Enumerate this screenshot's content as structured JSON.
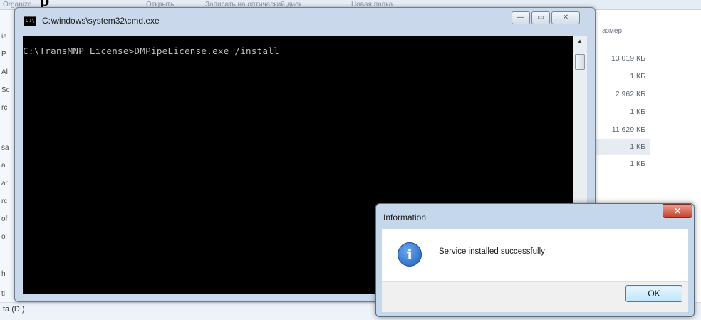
{
  "background": {
    "heading_fragment": "р",
    "toolbar": [
      "Organize",
      "Открыть",
      "Записать на оптический диск",
      "Новая папка"
    ],
    "left_pane_fragments": [
      "ia",
      "P",
      "Al",
      "Sc",
      "rc",
      "sa",
      "a",
      "ar",
      "rc",
      "of",
      "ol",
      "h",
      "ti"
    ],
    "column_header": "азмер",
    "file_sizes": [
      "13 019 КБ",
      "1 КБ",
      "2 962 КБ",
      "1 КБ",
      "11 629 КБ",
      "1 КБ",
      "1 КБ"
    ],
    "status_drive": "ta (D:)"
  },
  "cmd": {
    "title": "C:\\windows\\system32\\cmd.exe",
    "icon_label": "C:\\",
    "command_line": "C:\\TransMNP_License>DMPipeLicense.exe /install",
    "minimize_label": "—",
    "maximize_label": "▭",
    "close_label": "✕"
  },
  "dialog": {
    "title": "Information",
    "message": "Service installed successfully",
    "ok_label": "OK",
    "close_label": "✕",
    "icon_glyph": "i"
  },
  "colors": {
    "console_bg": "#000000",
    "console_text": "#c0c0c0",
    "window_frame": "#c9d9eb",
    "close_red": "#c5402a"
  },
  "icons": [
    "cmd-icon",
    "information-icon",
    "scroll-up-icon",
    "scroll-down-icon"
  ]
}
